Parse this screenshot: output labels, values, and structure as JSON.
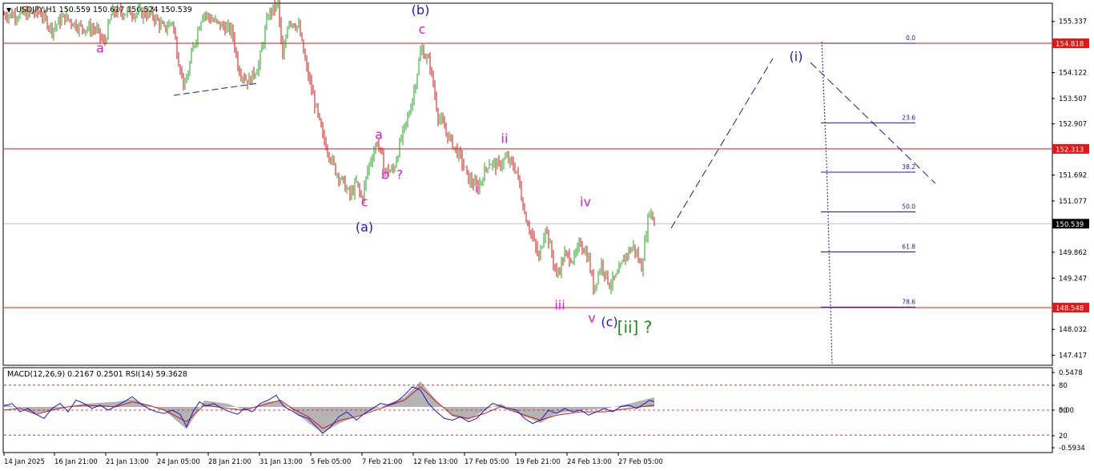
{
  "header": {
    "symbol_text": "USDJPY,H1  150.559 150.617 150.524 150.539",
    "indicator_text": "MACD(12,26,9) 0.2167 0.2501  RSI(14) 59.3628"
  },
  "colors": {
    "background": "#ffffff",
    "bull_candle": "#1fa31f",
    "bear_candle": "#d01010",
    "hline": "#e01818",
    "fib": "#1a1ab0",
    "wave_magenta": "#e316e3",
    "wave_blue": "#1a1ad6",
    "wave_green": "#1b8a1b",
    "macd_hist": "#b4b4b4",
    "rsi_line": "#1818d0",
    "signal_line": "#cc1c1c"
  },
  "chart_data": [
    {
      "type": "line",
      "title": "USDJPY,H1",
      "x": [
        "14 Jan 2025",
        "16 Jan 21:00",
        "21 Jan 13:00",
        "24 Jan 05:00",
        "28 Jan 21:00",
        "31 Jan 13:00",
        "5 Feb 05:00",
        "7 Feb 21:00",
        "12 Feb 13:00",
        "17 Feb 05:00",
        "19 Feb 21:00",
        "24 Feb 13:00",
        "27 Feb 05:00"
      ],
      "ylim": [
        147.2,
        155.75
      ],
      "y_ticks": [
        "155.337",
        "154.122",
        "153.507",
        "152.907",
        "151.692",
        "151.077",
        "149.862",
        "149.247",
        "148.032",
        "147.417"
      ],
      "price_path": [
        [
          0,
          155.5
        ],
        [
          25,
          155.5
        ],
        [
          45,
          155.55
        ],
        [
          60,
          155.15
        ],
        [
          75,
          155.45
        ],
        [
          95,
          155.2
        ],
        [
          115,
          155.15
        ],
        [
          125,
          154.8
        ],
        [
          135,
          155.55
        ],
        [
          160,
          155.55
        ],
        [
          185,
          155.5
        ],
        [
          200,
          155.15
        ],
        [
          210,
          155.35
        ],
        [
          218,
          154.4
        ],
        [
          226,
          153.75
        ],
        [
          236,
          154.7
        ],
        [
          248,
          155.55
        ],
        [
          265,
          155.3
        ],
        [
          285,
          155.1
        ],
        [
          293,
          154.2
        ],
        [
          305,
          153.9
        ],
        [
          318,
          154.3
        ],
        [
          330,
          155.5
        ],
        [
          342,
          155.75
        ],
        [
          348,
          154.4
        ],
        [
          355,
          155.4
        ],
        [
          368,
          155.2
        ],
        [
          378,
          154.2
        ],
        [
          388,
          153.4
        ],
        [
          398,
          152.6
        ],
        [
          406,
          152.2
        ],
        [
          414,
          151.8
        ],
        [
          424,
          151.5
        ],
        [
          432,
          151.2
        ],
        [
          440,
          151.5
        ],
        [
          447,
          151.1
        ],
        [
          455,
          151.9
        ],
        [
          466,
          152.5
        ],
        [
          476,
          151.8
        ],
        [
          486,
          151.8
        ],
        [
          496,
          152.55
        ],
        [
          505,
          153.1
        ],
        [
          512,
          153.7
        ],
        [
          521,
          154.7
        ],
        [
          532,
          154.3
        ],
        [
          542,
          153.1
        ],
        [
          555,
          152.6
        ],
        [
          570,
          152.1
        ],
        [
          580,
          151.6
        ],
        [
          592,
          151.4
        ],
        [
          605,
          152.0
        ],
        [
          617,
          151.9
        ],
        [
          627,
          152.1
        ],
        [
          640,
          151.8
        ],
        [
          650,
          150.8
        ],
        [
          660,
          150.2
        ],
        [
          668,
          149.7
        ],
        [
          676,
          150.5
        ],
        [
          690,
          149.3
        ],
        [
          700,
          149.8
        ],
        [
          712,
          149.7
        ],
        [
          720,
          150.1
        ],
        [
          730,
          149.7
        ],
        [
          736,
          149.0
        ],
        [
          746,
          149.6
        ],
        [
          756,
          149.1
        ],
        [
          766,
          149.3
        ],
        [
          776,
          149.8
        ],
        [
          786,
          150.0
        ],
        [
          796,
          149.5
        ],
        [
          806,
          150.9
        ],
        [
          813,
          150.5
        ]
      ],
      "horizontal_lines": [
        {
          "label": "154.818",
          "value": 154.818
        },
        {
          "label": "152.313",
          "value": 152.313
        },
        {
          "label": "148.548",
          "value": 148.548
        }
      ],
      "current_price": {
        "label": "150.539",
        "value": 150.539
      },
      "fib_retracement": [
        {
          "level": "0.0",
          "value": 154.818
        },
        {
          "level": "23.6",
          "value": 152.93
        },
        {
          "level": "38.2",
          "value": 151.76
        },
        {
          "level": "50.0",
          "value": 150.82
        },
        {
          "level": "61.8",
          "value": 149.87
        },
        {
          "level": "78.6",
          "value": 148.56
        }
      ],
      "wave_labels": [
        {
          "text": "a",
          "color": "magenta",
          "price": 154.6,
          "bar": 120
        },
        {
          "text": "(b)",
          "color": "blue",
          "price": 155.5,
          "bar": 520
        },
        {
          "text": "c",
          "color": "magenta",
          "price": 155.05,
          "bar": 522
        },
        {
          "text": "a",
          "color": "magenta",
          "price": 152.55,
          "bar": 468
        },
        {
          "text": "b",
          "color": "magenta",
          "price": 151.6,
          "bar": 476
        },
        {
          "text": "?",
          "color": "magenta",
          "price": 151.6,
          "bar": 494
        },
        {
          "text": "c",
          "color": "magenta",
          "price": 150.95,
          "bar": 450
        },
        {
          "text": "(a)",
          "color": "blue",
          "price": 150.35,
          "bar": 450
        },
        {
          "text": "ii",
          "color": "magenta",
          "price": 152.45,
          "bar": 625
        },
        {
          "text": "i",
          "color": "magenta",
          "price": 151.28,
          "bar": 590
        },
        {
          "text": "iv",
          "color": "magenta",
          "price": 150.95,
          "bar": 726
        },
        {
          "text": "iii",
          "color": "magenta",
          "price": 148.5,
          "bar": 694
        },
        {
          "text": "v",
          "color": "magenta",
          "price": 148.2,
          "bar": 734
        },
        {
          "text": "(c)",
          "color": "blue",
          "price": 148.1,
          "bar": 756
        },
        {
          "text": "[ii]",
          "color": "green",
          "price": 147.95,
          "bar": 779
        },
        {
          "text": "?",
          "color": "green",
          "price": 147.95,
          "bar": 804
        },
        {
          "text": "(i)",
          "color": "blue",
          "price": 154.4,
          "bar": 989
        }
      ]
    },
    {
      "type": "line",
      "title": "MACD(12,26,9) RSI(14)",
      "ylim": [
        -0.7,
        0.6
      ],
      "y_ticks": [
        "0.5478",
        "80",
        "0.00",
        "50",
        "20",
        "-0.5934"
      ],
      "rsi_path": [
        [
          0,
          55
        ],
        [
          10,
          58
        ],
        [
          20,
          48
        ],
        [
          30,
          52
        ],
        [
          40,
          45
        ],
        [
          50,
          40
        ],
        [
          60,
          52
        ],
        [
          70,
          58
        ],
        [
          80,
          48
        ],
        [
          90,
          62
        ],
        [
          100,
          58
        ],
        [
          110,
          52
        ],
        [
          120,
          56
        ],
        [
          130,
          50
        ],
        [
          140,
          55
        ],
        [
          150,
          60
        ],
        [
          160,
          66
        ],
        [
          170,
          58
        ],
        [
          180,
          52
        ],
        [
          190,
          48
        ],
        [
          200,
          46
        ],
        [
          210,
          50
        ],
        [
          220,
          45
        ],
        [
          228,
          30
        ],
        [
          236,
          48
        ],
        [
          244,
          60
        ],
        [
          252,
          55
        ],
        [
          262,
          58
        ],
        [
          272,
          52
        ],
        [
          282,
          48
        ],
        [
          292,
          45
        ],
        [
          300,
          52
        ],
        [
          310,
          48
        ],
        [
          320,
          58
        ],
        [
          330,
          62
        ],
        [
          340,
          68
        ],
        [
          345,
          60
        ],
        [
          350,
          54
        ],
        [
          358,
          50
        ],
        [
          368,
          44
        ],
        [
          380,
          40
        ],
        [
          390,
          30
        ],
        [
          398,
          22
        ],
        [
          408,
          30
        ],
        [
          418,
          42
        ],
        [
          428,
          48
        ],
        [
          440,
          38
        ],
        [
          450,
          46
        ],
        [
          460,
          52
        ],
        [
          470,
          58
        ],
        [
          480,
          56
        ],
        [
          490,
          60
        ],
        [
          500,
          68
        ],
        [
          510,
          78
        ],
        [
          520,
          74
        ],
        [
          530,
          58
        ],
        [
          540,
          48
        ],
        [
          550,
          40
        ],
        [
          560,
          38
        ],
        [
          570,
          42
        ],
        [
          580,
          36
        ],
        [
          590,
          40
        ],
        [
          600,
          50
        ],
        [
          610,
          58
        ],
        [
          620,
          55
        ],
        [
          630,
          52
        ],
        [
          640,
          50
        ],
        [
          650,
          40
        ],
        [
          660,
          34
        ],
        [
          670,
          38
        ],
        [
          680,
          50
        ],
        [
          690,
          46
        ],
        [
          700,
          52
        ],
        [
          710,
          48
        ],
        [
          720,
          50
        ],
        [
          730,
          44
        ],
        [
          740,
          48
        ],
        [
          750,
          52
        ],
        [
          760,
          48
        ],
        [
          770,
          54
        ],
        [
          780,
          56
        ],
        [
          790,
          52
        ],
        [
          800,
          58
        ],
        [
          806,
          62
        ],
        [
          812,
          60
        ]
      ],
      "signal_path": [
        [
          0,
          50
        ],
        [
          20,
          52
        ],
        [
          40,
          45
        ],
        [
          60,
          50
        ],
        [
          80,
          54
        ],
        [
          100,
          56
        ],
        [
          120,
          55
        ],
        [
          140,
          54
        ],
        [
          160,
          60
        ],
        [
          180,
          56
        ],
        [
          200,
          50
        ],
        [
          228,
          36
        ],
        [
          250,
          56
        ],
        [
          280,
          52
        ],
        [
          300,
          50
        ],
        [
          330,
          58
        ],
        [
          345,
          62
        ],
        [
          360,
          52
        ],
        [
          380,
          42
        ],
        [
          398,
          28
        ],
        [
          420,
          38
        ],
        [
          440,
          42
        ],
        [
          470,
          52
        ],
        [
          500,
          62
        ],
        [
          520,
          78
        ],
        [
          540,
          60
        ],
        [
          560,
          44
        ],
        [
          580,
          40
        ],
        [
          600,
          46
        ],
        [
          620,
          54
        ],
        [
          650,
          44
        ],
        [
          670,
          38
        ],
        [
          690,
          44
        ],
        [
          720,
          48
        ],
        [
          750,
          48
        ],
        [
          780,
          52
        ],
        [
          812,
          56
        ]
      ],
      "macd_hist": [
        [
          0,
          0.05
        ],
        [
          40,
          -0.1
        ],
        [
          60,
          -0.05
        ],
        [
          100,
          0.05
        ],
        [
          140,
          0.08
        ],
        [
          160,
          0.12
        ],
        [
          180,
          0.02
        ],
        [
          200,
          -0.05
        ],
        [
          228,
          -0.35
        ],
        [
          250,
          0.1
        ],
        [
          280,
          0.05
        ],
        [
          300,
          -0.05
        ],
        [
          330,
          0.08
        ],
        [
          345,
          0.1
        ],
        [
          360,
          -0.05
        ],
        [
          380,
          -0.25
        ],
        [
          398,
          -0.4
        ],
        [
          420,
          -0.25
        ],
        [
          440,
          -0.15
        ],
        [
          470,
          0.0
        ],
        [
          500,
          0.15
        ],
        [
          520,
          0.4
        ],
        [
          540,
          0.1
        ],
        [
          560,
          -0.15
        ],
        [
          580,
          -0.2
        ],
        [
          600,
          -0.05
        ],
        [
          620,
          0.05
        ],
        [
          650,
          -0.15
        ],
        [
          670,
          -0.25
        ],
        [
          690,
          -0.1
        ],
        [
          720,
          -0.05
        ],
        [
          750,
          -0.03
        ],
        [
          780,
          0.05
        ],
        [
          812,
          0.15
        ]
      ]
    }
  ]
}
